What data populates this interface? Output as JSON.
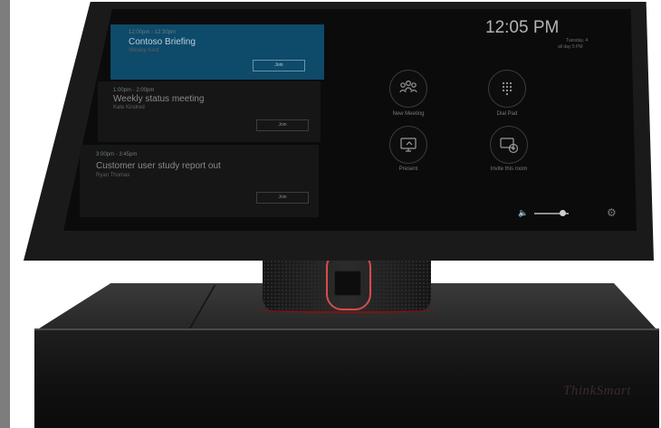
{
  "clock": {
    "time": "12:05 PM",
    "subline_1": "Tuesday, 4",
    "subline_2": "all day 5 PM"
  },
  "meetings": [
    {
      "time": "12:00pm - 12:30pm",
      "title": "Contoso Briefing",
      "organizer": "Wesley Kent",
      "join_label": "Join",
      "selected": true
    },
    {
      "time": "1:00pm - 2:00pm",
      "title": "Weekly status meeting",
      "organizer": "Kate Kindred",
      "join_label": "Join",
      "selected": false
    },
    {
      "time": "3:00pm - 3:45pm",
      "title": "Customer user study report out",
      "organizer": "Ryan Thomas",
      "join_label": "Join",
      "selected": false
    }
  ],
  "actions": [
    {
      "label": "New Meeting",
      "icon": "people-group-icon"
    },
    {
      "label": "Dial Pad",
      "icon": "dialpad-icon"
    },
    {
      "label": "Present",
      "icon": "present-screen-icon"
    },
    {
      "label": "Invite this room",
      "icon": "invite-screen-icon"
    }
  ],
  "controls": {
    "volume_level": 0.72,
    "volume_icon": "speaker-icon",
    "settings_icon": "gear-icon"
  },
  "device": {
    "brand": "ThinkSmart"
  },
  "colors": {
    "accent_card": "#0e4a6a",
    "camera_highlight": "#d94b4b",
    "accent_ring": "#7a1515"
  }
}
